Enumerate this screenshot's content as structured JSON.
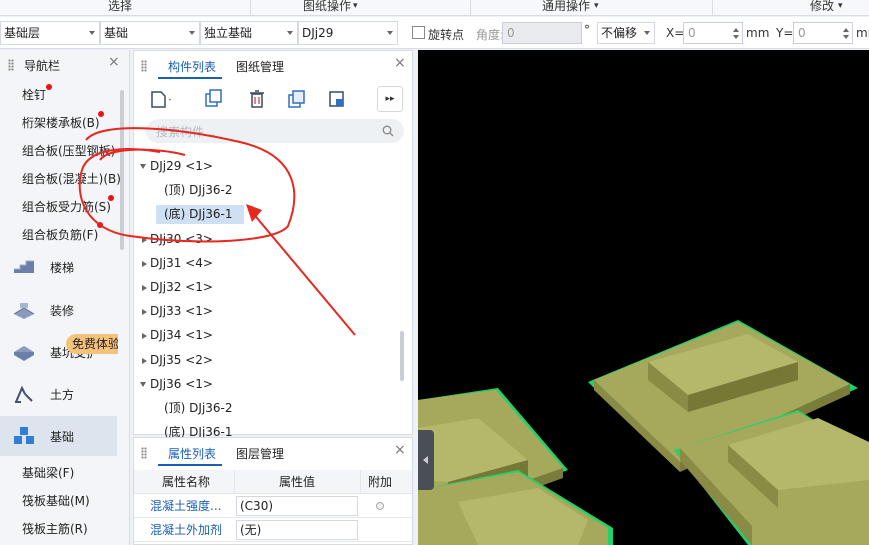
{
  "ribbon": {
    "groups": [
      "选择",
      "图纸操作",
      "通用操作",
      "修改"
    ]
  },
  "toolbar": {
    "floor_combo": "基础层",
    "category_combo": "基础",
    "type_combo": "独立基础",
    "component_combo": "DJj29",
    "rotate_point_label": "旋转点",
    "angle_label": "角度:",
    "angle_value": "0",
    "degree_unit": "°",
    "offset_combo": "不偏移",
    "x_label": "X=",
    "x_value": "0",
    "x_unit": "mm",
    "y_label": "Y=",
    "y_value": "0",
    "y_unit": "mm"
  },
  "nav": {
    "title": "导航栏",
    "close_glyph": "×",
    "items_top": [
      "栓钉",
      "桁架楼承板(B)",
      "组合板(压型钢板)",
      "组合板(混凝土)(B)",
      "组合板受力筋(S)",
      "组合板负筋(F)"
    ],
    "categories": [
      "楼梯",
      "装修",
      "基坑支护",
      "土方",
      "基础"
    ],
    "active_category": "基础",
    "items_bottom": [
      "基础梁(F)",
      "筏板基础(M)",
      "筏板主筋(R)"
    ],
    "trial_badge": "免费体验"
  },
  "component_list": {
    "tabs": [
      "构件列表",
      "图纸管理"
    ],
    "active_tab": "构件列表",
    "close_glyph": "×",
    "search_placeholder": "搜索构件...",
    "tree": [
      {
        "label": "DJj29 <1>",
        "level": 0,
        "expanded": true
      },
      {
        "label": "(顶) DJj36-2",
        "level": 1
      },
      {
        "label": "(底) DJj36-1",
        "level": 1,
        "selected": true
      },
      {
        "label": "DJj30 <3>",
        "level": 0,
        "expanded": false
      },
      {
        "label": "DJj31 <4>",
        "level": 0,
        "expanded": false
      },
      {
        "label": "DJj32 <1>",
        "level": 0,
        "expanded": false
      },
      {
        "label": "DJj33 <1>",
        "level": 0,
        "expanded": false
      },
      {
        "label": "DJj34 <1>",
        "level": 0,
        "expanded": false
      },
      {
        "label": "DJj35 <2>",
        "level": 0,
        "expanded": false
      },
      {
        "label": "DJj36 <1>",
        "level": 0,
        "expanded": true
      },
      {
        "label": "(顶) DJj36-2",
        "level": 1
      },
      {
        "label": "(底) DJj36-1",
        "level": 1
      }
    ]
  },
  "properties": {
    "tabs": [
      "属性列表",
      "图层管理"
    ],
    "active_tab": "属性列表",
    "close_glyph": "×",
    "headers": [
      "属性名称",
      "属性值",
      "附加"
    ],
    "rows": [
      {
        "name": "混凝土强度...",
        "value": "(C30)"
      },
      {
        "name": "混凝土外加剂",
        "value": "(无)"
      }
    ]
  },
  "colors": {
    "accent": "#1a5fb4",
    "footing_top": "#a6a95c",
    "footing_side": "#8a8c45",
    "footing_edge": "#1fd36a",
    "annotation_red": "#e8281e"
  }
}
